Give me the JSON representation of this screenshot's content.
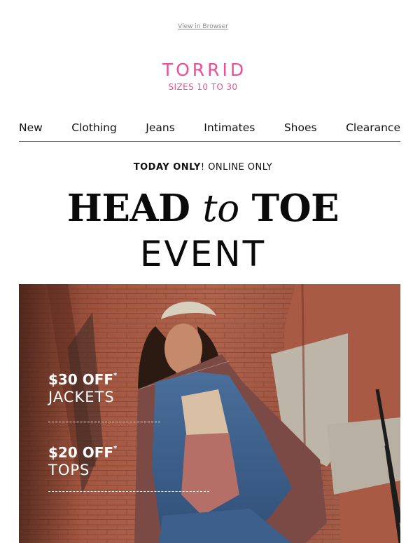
{
  "header": {
    "view_in_browser": "View in Browser"
  },
  "logo": {
    "wordmark": "TORRID",
    "tagline": "SIZES 10 TO 30",
    "color": "#ec4f95"
  },
  "nav": {
    "items": [
      "New",
      "Clothing",
      "Jeans",
      "Intimates",
      "Shoes",
      "Clearance"
    ]
  },
  "promo": {
    "timing_bold": "TODAY ONLY",
    "timing_rest": "! ONLINE ONLY",
    "headline_part1": "HEAD ",
    "headline_part2": "to",
    "headline_part3": " TOE",
    "subhead": "EVENT"
  },
  "hero": {
    "offers": [
      {
        "amount": "$30 OFF",
        "asterisk": "*",
        "category": "JACKETS"
      },
      {
        "amount": "$20 OFF",
        "asterisk": "*",
        "category": "TOPS"
      }
    ]
  }
}
